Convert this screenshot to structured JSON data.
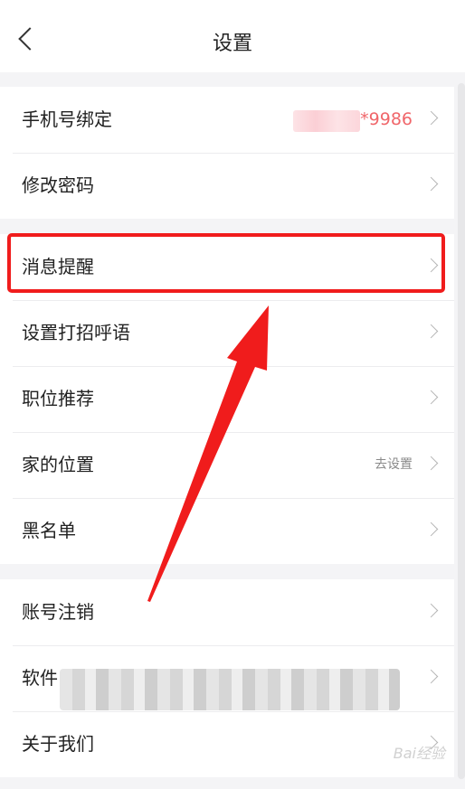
{
  "nav": {
    "title": "设置"
  },
  "group1": [
    {
      "label": "手机号绑定",
      "value": "*9986"
    },
    {
      "label": "修改密码"
    }
  ],
  "group2": [
    {
      "label": "消息提醒"
    },
    {
      "label": "设置打招呼语"
    },
    {
      "label": "职位推荐"
    },
    {
      "label": "家的位置",
      "sub": "去设置"
    },
    {
      "label": "黑名单"
    }
  ],
  "group3": [
    {
      "label": "账号注销"
    },
    {
      "label": "软件"
    },
    {
      "label": "关于我们"
    }
  ],
  "colors": {
    "annotation": "#f01c1c",
    "phone_value": "#f0666a"
  },
  "watermark": "Bai经验"
}
